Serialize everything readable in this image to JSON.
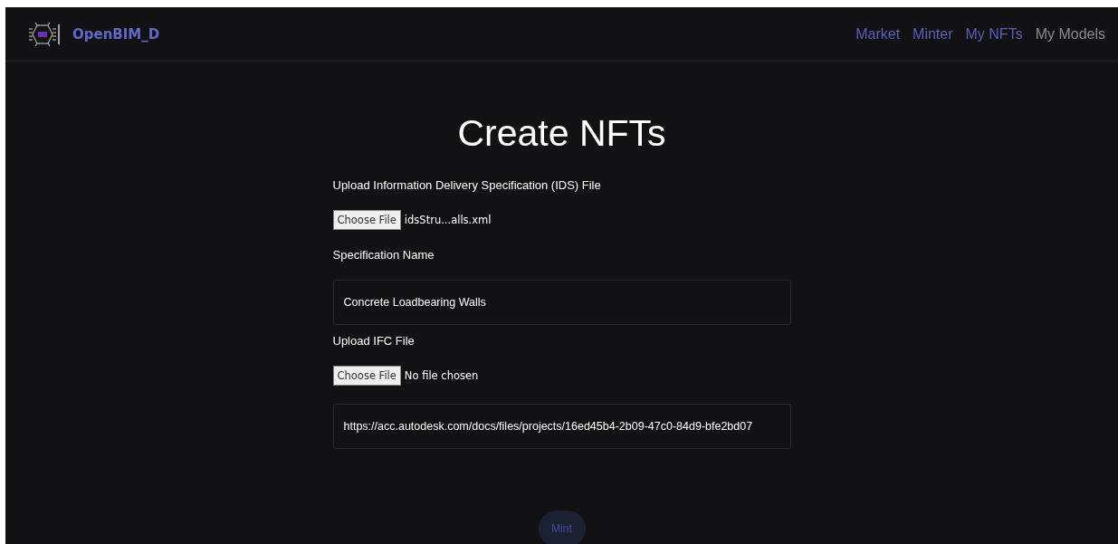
{
  "brand": {
    "name": "OpenBIM_D"
  },
  "nav": [
    {
      "label": "Market",
      "selected": false
    },
    {
      "label": "Minter",
      "selected": false
    },
    {
      "label": "My NFTs",
      "selected": false
    },
    {
      "label": "My Models",
      "selected": true
    }
  ],
  "heading": "Create NFTs",
  "form": [
    {
      "kind": "label",
      "text": "Upload Information Delivery Specification (IDS) File"
    },
    {
      "kind": "file",
      "button": "Choose File",
      "filename": "idsStru...alls.xml"
    },
    {
      "kind": "label",
      "text": "Specification Name"
    },
    {
      "kind": "text",
      "value": "Concrete Loadbearing Walls"
    },
    {
      "kind": "label",
      "text": "Upload IFC File"
    },
    {
      "kind": "file",
      "button": "Choose File",
      "filename": "No file chosen"
    },
    {
      "kind": "text",
      "value": "https://acc.autodesk.com/docs/files/projects/16ed45b4-2b09-47c0-84d9-bfe2bd07"
    }
  ],
  "submit": {
    "label": "Mint",
    "disabled": true
  }
}
